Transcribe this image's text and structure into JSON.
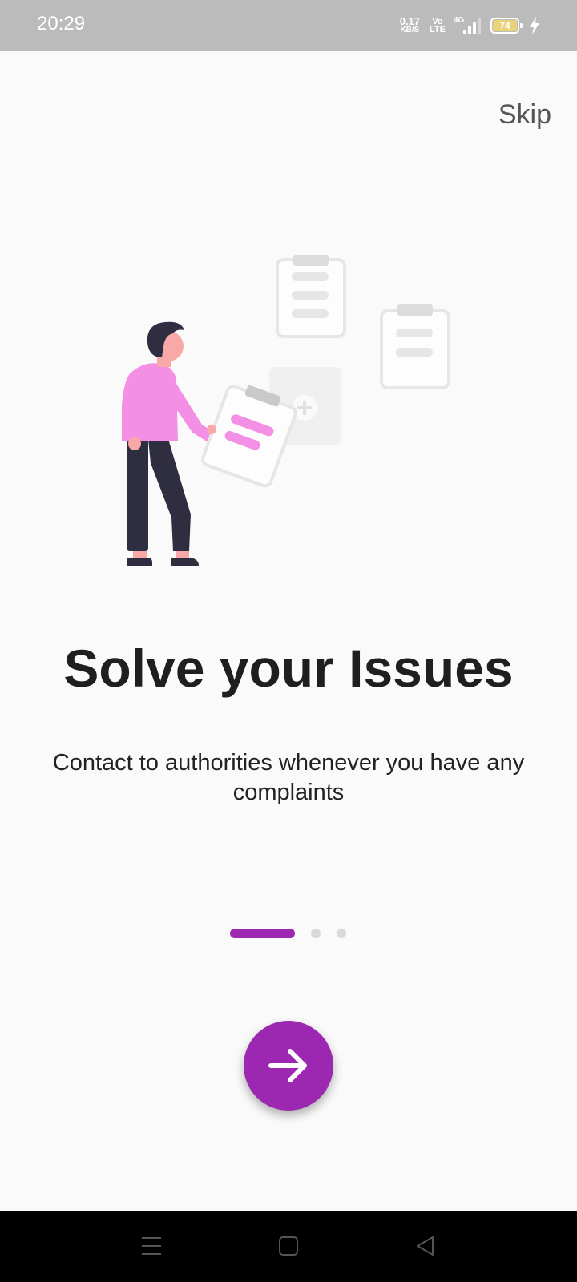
{
  "status_bar": {
    "time": "20:29",
    "net_speed_value": "0.17",
    "net_speed_unit": "KB/S",
    "volte_top": "Vo",
    "volte_bottom": "LTE",
    "network_type": "4G",
    "battery_level": "74"
  },
  "onboarding": {
    "skip_label": "Skip",
    "title": "Solve your Issues",
    "subtitle": "Contact to authorities whenever you have any complaints",
    "page_indicator": {
      "current": 1,
      "total": 3
    }
  },
  "colors": {
    "accent": "#9c27b0",
    "illustration_pink": "#f48fe6",
    "illustration_dark": "#2f2e41"
  },
  "icons": {
    "next": "arrow-right-icon",
    "nav_menu": "menu-icon",
    "nav_home": "home-square-icon",
    "nav_back": "back-triangle-icon"
  }
}
